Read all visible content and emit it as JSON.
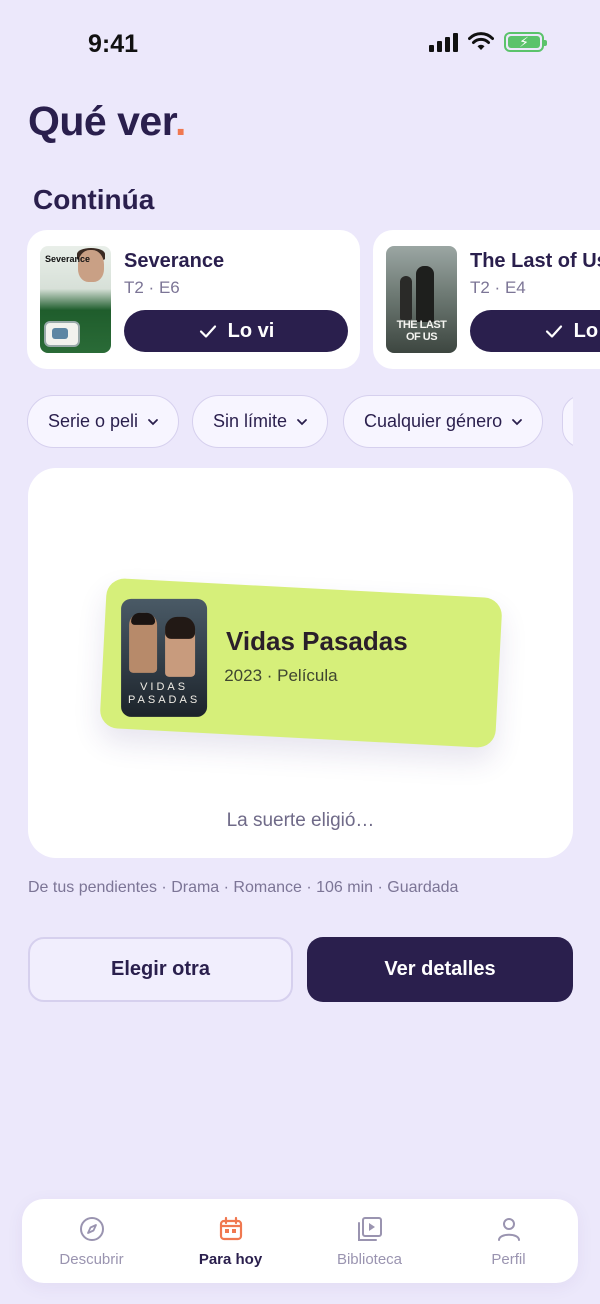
{
  "status_bar": {
    "time": "9:41"
  },
  "header": {
    "title": "Qué ver",
    "title_dot": "."
  },
  "continue_section": {
    "title": "Continúa",
    "items": [
      {
        "name": "Severance",
        "episode": "T2 · E6",
        "action_label": "Lo vi",
        "poster_text": "Severance"
      },
      {
        "name": "The Last of Us",
        "episode": "T2 · E4",
        "action_label": "Lo vi",
        "poster_text": "THE LAST OF US"
      }
    ]
  },
  "filters": [
    {
      "label": "Serie o peli"
    },
    {
      "label": "Sin límite"
    },
    {
      "label": "Cualquier género"
    }
  ],
  "pick": {
    "title": "Vidas Pasadas",
    "meta": "2023 · Película",
    "poster_text": "VIDAS PASADAS",
    "status": "La suerte eligió…",
    "details_line": "De tus pendientes · Drama · Romance · 106 min · Guardada"
  },
  "actions": {
    "secondary_label": "Elegir otra",
    "primary_label": "Ver detalles"
  },
  "tab_bar": {
    "items": [
      {
        "label": "Descubrir",
        "icon": "compass-icon",
        "active": false
      },
      {
        "label": "Para hoy",
        "icon": "calendar-icon",
        "active": true
      },
      {
        "label": "Biblioteca",
        "icon": "play-library-icon",
        "active": false
      },
      {
        "label": "Perfil",
        "icon": "user-icon",
        "active": false
      }
    ]
  },
  "colors": {
    "accent": "#F07850",
    "primary": "#2A1F4D",
    "background": "#ECE8FB",
    "pick_card": "#D6EF7A"
  }
}
